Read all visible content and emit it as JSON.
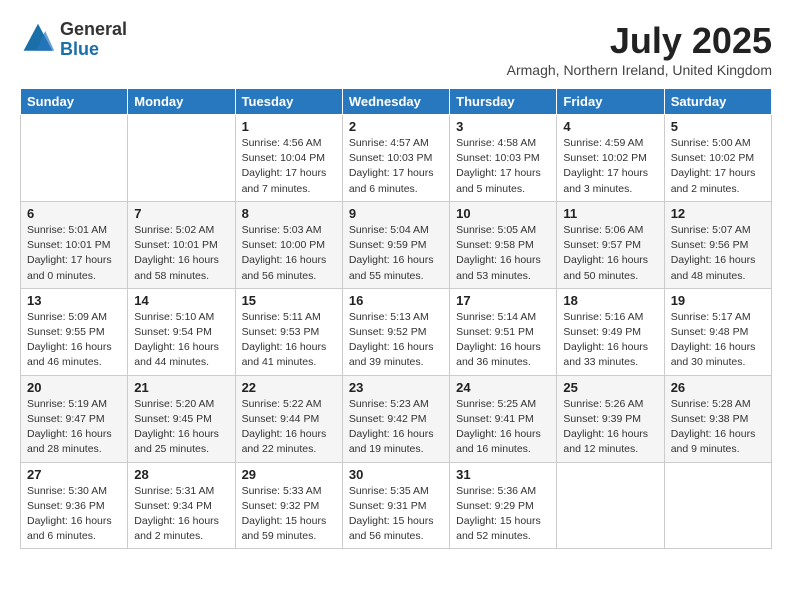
{
  "logo": {
    "general": "General",
    "blue": "Blue"
  },
  "title": {
    "month_year": "July 2025",
    "location": "Armagh, Northern Ireland, United Kingdom"
  },
  "headers": [
    "Sunday",
    "Monday",
    "Tuesday",
    "Wednesday",
    "Thursday",
    "Friday",
    "Saturday"
  ],
  "weeks": [
    [
      {
        "day": "",
        "info": ""
      },
      {
        "day": "",
        "info": ""
      },
      {
        "day": "1",
        "info": "Sunrise: 4:56 AM\nSunset: 10:04 PM\nDaylight: 17 hours\nand 7 minutes."
      },
      {
        "day": "2",
        "info": "Sunrise: 4:57 AM\nSunset: 10:03 PM\nDaylight: 17 hours\nand 6 minutes."
      },
      {
        "day": "3",
        "info": "Sunrise: 4:58 AM\nSunset: 10:03 PM\nDaylight: 17 hours\nand 5 minutes."
      },
      {
        "day": "4",
        "info": "Sunrise: 4:59 AM\nSunset: 10:02 PM\nDaylight: 17 hours\nand 3 minutes."
      },
      {
        "day": "5",
        "info": "Sunrise: 5:00 AM\nSunset: 10:02 PM\nDaylight: 17 hours\nand 2 minutes."
      }
    ],
    [
      {
        "day": "6",
        "info": "Sunrise: 5:01 AM\nSunset: 10:01 PM\nDaylight: 17 hours\nand 0 minutes."
      },
      {
        "day": "7",
        "info": "Sunrise: 5:02 AM\nSunset: 10:01 PM\nDaylight: 16 hours\nand 58 minutes."
      },
      {
        "day": "8",
        "info": "Sunrise: 5:03 AM\nSunset: 10:00 PM\nDaylight: 16 hours\nand 56 minutes."
      },
      {
        "day": "9",
        "info": "Sunrise: 5:04 AM\nSunset: 9:59 PM\nDaylight: 16 hours\nand 55 minutes."
      },
      {
        "day": "10",
        "info": "Sunrise: 5:05 AM\nSunset: 9:58 PM\nDaylight: 16 hours\nand 53 minutes."
      },
      {
        "day": "11",
        "info": "Sunrise: 5:06 AM\nSunset: 9:57 PM\nDaylight: 16 hours\nand 50 minutes."
      },
      {
        "day": "12",
        "info": "Sunrise: 5:07 AM\nSunset: 9:56 PM\nDaylight: 16 hours\nand 48 minutes."
      }
    ],
    [
      {
        "day": "13",
        "info": "Sunrise: 5:09 AM\nSunset: 9:55 PM\nDaylight: 16 hours\nand 46 minutes."
      },
      {
        "day": "14",
        "info": "Sunrise: 5:10 AM\nSunset: 9:54 PM\nDaylight: 16 hours\nand 44 minutes."
      },
      {
        "day": "15",
        "info": "Sunrise: 5:11 AM\nSunset: 9:53 PM\nDaylight: 16 hours\nand 41 minutes."
      },
      {
        "day": "16",
        "info": "Sunrise: 5:13 AM\nSunset: 9:52 PM\nDaylight: 16 hours\nand 39 minutes."
      },
      {
        "day": "17",
        "info": "Sunrise: 5:14 AM\nSunset: 9:51 PM\nDaylight: 16 hours\nand 36 minutes."
      },
      {
        "day": "18",
        "info": "Sunrise: 5:16 AM\nSunset: 9:49 PM\nDaylight: 16 hours\nand 33 minutes."
      },
      {
        "day": "19",
        "info": "Sunrise: 5:17 AM\nSunset: 9:48 PM\nDaylight: 16 hours\nand 30 minutes."
      }
    ],
    [
      {
        "day": "20",
        "info": "Sunrise: 5:19 AM\nSunset: 9:47 PM\nDaylight: 16 hours\nand 28 minutes."
      },
      {
        "day": "21",
        "info": "Sunrise: 5:20 AM\nSunset: 9:45 PM\nDaylight: 16 hours\nand 25 minutes."
      },
      {
        "day": "22",
        "info": "Sunrise: 5:22 AM\nSunset: 9:44 PM\nDaylight: 16 hours\nand 22 minutes."
      },
      {
        "day": "23",
        "info": "Sunrise: 5:23 AM\nSunset: 9:42 PM\nDaylight: 16 hours\nand 19 minutes."
      },
      {
        "day": "24",
        "info": "Sunrise: 5:25 AM\nSunset: 9:41 PM\nDaylight: 16 hours\nand 16 minutes."
      },
      {
        "day": "25",
        "info": "Sunrise: 5:26 AM\nSunset: 9:39 PM\nDaylight: 16 hours\nand 12 minutes."
      },
      {
        "day": "26",
        "info": "Sunrise: 5:28 AM\nSunset: 9:38 PM\nDaylight: 16 hours\nand 9 minutes."
      }
    ],
    [
      {
        "day": "27",
        "info": "Sunrise: 5:30 AM\nSunset: 9:36 PM\nDaylight: 16 hours\nand 6 minutes."
      },
      {
        "day": "28",
        "info": "Sunrise: 5:31 AM\nSunset: 9:34 PM\nDaylight: 16 hours\nand 2 minutes."
      },
      {
        "day": "29",
        "info": "Sunrise: 5:33 AM\nSunset: 9:32 PM\nDaylight: 15 hours\nand 59 minutes."
      },
      {
        "day": "30",
        "info": "Sunrise: 5:35 AM\nSunset: 9:31 PM\nDaylight: 15 hours\nand 56 minutes."
      },
      {
        "day": "31",
        "info": "Sunrise: 5:36 AM\nSunset: 9:29 PM\nDaylight: 15 hours\nand 52 minutes."
      },
      {
        "day": "",
        "info": ""
      },
      {
        "day": "",
        "info": ""
      }
    ]
  ]
}
